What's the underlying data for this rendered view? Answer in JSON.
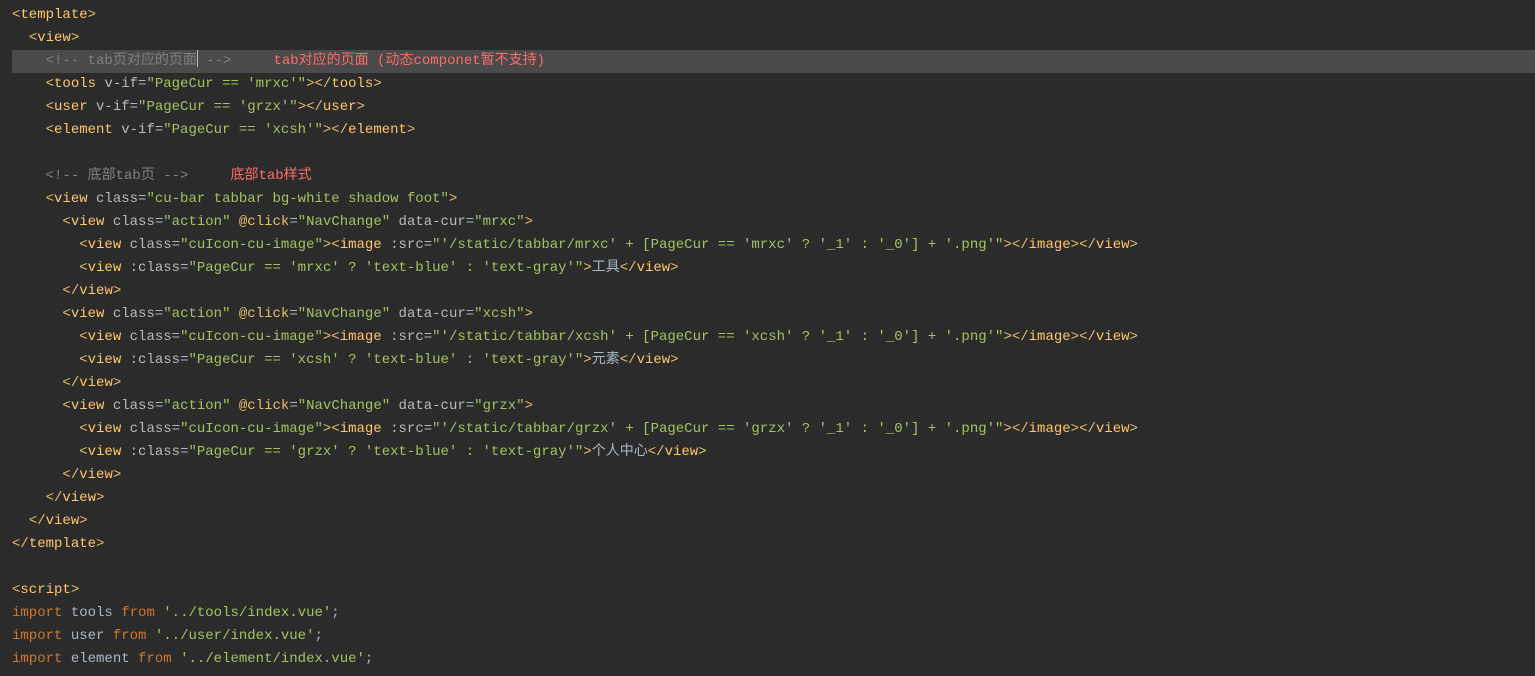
{
  "lines": {
    "l1": {
      "indent": "",
      "tokens": [
        {
          "t": "t-tag",
          "s": "<"
        },
        {
          "t": "t-custom",
          "s": "template"
        },
        {
          "t": "t-tag",
          "s": ">"
        }
      ]
    },
    "l2": {
      "indent": "  ",
      "tokens": [
        {
          "t": "t-tag",
          "s": "<"
        },
        {
          "t": "t-custom",
          "s": "view"
        },
        {
          "t": "t-tag",
          "s": ">"
        }
      ]
    },
    "l3": {
      "indent": "    ",
      "active": true,
      "tokens": [
        {
          "t": "t-comment",
          "s": "<!-- tab页对应的页面"
        },
        {
          "cursor": true
        },
        {
          "t": "t-comment",
          "s": " -->"
        },
        {
          "t": "t-text",
          "s": "     "
        },
        {
          "t": "t-anno",
          "s": "tab对应的页面 (动态componet暂不支持)"
        }
      ]
    },
    "l4": {
      "indent": "    ",
      "tokens": [
        {
          "t": "t-tag",
          "s": "<"
        },
        {
          "t": "t-custom",
          "s": "tools"
        },
        {
          "t": "t-text",
          "s": " "
        },
        {
          "t": "t-attr",
          "s": "v-if"
        },
        {
          "t": "t-eq",
          "s": "="
        },
        {
          "t": "t-str",
          "s": "\"PageCur == 'mrxc'\""
        },
        {
          "t": "t-tag",
          "s": "></"
        },
        {
          "t": "t-custom",
          "s": "tools"
        },
        {
          "t": "t-tag",
          "s": ">"
        }
      ]
    },
    "l5": {
      "indent": "    ",
      "tokens": [
        {
          "t": "t-tag",
          "s": "<"
        },
        {
          "t": "t-custom",
          "s": "user"
        },
        {
          "t": "t-text",
          "s": " "
        },
        {
          "t": "t-attr",
          "s": "v-if"
        },
        {
          "t": "t-eq",
          "s": "="
        },
        {
          "t": "t-str",
          "s": "\"PageCur == 'grzx'\""
        },
        {
          "t": "t-tag",
          "s": "></"
        },
        {
          "t": "t-custom",
          "s": "user"
        },
        {
          "t": "t-tag",
          "s": ">"
        }
      ]
    },
    "l6": {
      "indent": "    ",
      "tokens": [
        {
          "t": "t-tag",
          "s": "<"
        },
        {
          "t": "t-custom",
          "s": "element"
        },
        {
          "t": "t-text",
          "s": " "
        },
        {
          "t": "t-attr",
          "s": "v-if"
        },
        {
          "t": "t-eq",
          "s": "="
        },
        {
          "t": "t-str",
          "s": "\"PageCur == 'xcsh'\""
        },
        {
          "t": "t-tag",
          "s": "></"
        },
        {
          "t": "t-custom",
          "s": "element"
        },
        {
          "t": "t-tag",
          "s": ">"
        }
      ]
    },
    "l7": {
      "indent": "",
      "tokens": []
    },
    "l8": {
      "indent": "    ",
      "tokens": [
        {
          "t": "t-comment",
          "s": "<!-- 底部tab页 -->"
        },
        {
          "t": "t-text",
          "s": "     "
        },
        {
          "t": "t-anno",
          "s": "底部tab样式"
        }
      ]
    },
    "l9": {
      "indent": "    ",
      "tokens": [
        {
          "t": "t-tag",
          "s": "<"
        },
        {
          "t": "t-custom",
          "s": "view"
        },
        {
          "t": "t-text",
          "s": " "
        },
        {
          "t": "t-attr",
          "s": "class"
        },
        {
          "t": "t-eq",
          "s": "="
        },
        {
          "t": "t-str",
          "s": "\"cu-bar tabbar bg-white shadow foot\""
        },
        {
          "t": "t-tag",
          "s": ">"
        }
      ]
    },
    "l10": {
      "indent": "      ",
      "tokens": [
        {
          "t": "t-tag",
          "s": "<"
        },
        {
          "t": "t-custom",
          "s": "view"
        },
        {
          "t": "t-text",
          "s": " "
        },
        {
          "t": "t-attr",
          "s": "class"
        },
        {
          "t": "t-eq",
          "s": "="
        },
        {
          "t": "t-str",
          "s": "\"action\""
        },
        {
          "t": "t-text",
          "s": " "
        },
        {
          "t": "t-event",
          "s": "@click"
        },
        {
          "t": "t-eq",
          "s": "="
        },
        {
          "t": "t-str",
          "s": "\"NavChange\""
        },
        {
          "t": "t-text",
          "s": " "
        },
        {
          "t": "t-attr",
          "s": "data-cur"
        },
        {
          "t": "t-eq",
          "s": "="
        },
        {
          "t": "t-str",
          "s": "\"mrxc\""
        },
        {
          "t": "t-tag",
          "s": ">"
        }
      ]
    },
    "l11": {
      "indent": "        ",
      "tokens": [
        {
          "t": "t-tag",
          "s": "<"
        },
        {
          "t": "t-custom",
          "s": "view"
        },
        {
          "t": "t-text",
          "s": " "
        },
        {
          "t": "t-attr",
          "s": "class"
        },
        {
          "t": "t-eq",
          "s": "="
        },
        {
          "t": "t-str",
          "s": "\"cuIcon-cu-image\""
        },
        {
          "t": "t-tag",
          "s": "><"
        },
        {
          "t": "t-custom",
          "s": "image"
        },
        {
          "t": "t-text",
          "s": " "
        },
        {
          "t": "t-attr",
          "s": ":src"
        },
        {
          "t": "t-eq",
          "s": "="
        },
        {
          "t": "t-str",
          "s": "\"'/static/tabbar/mrxc' + [PageCur == 'mrxc' ? '_1' : '_0'] + '.png'\""
        },
        {
          "t": "t-tag",
          "s": "></"
        },
        {
          "t": "t-custom",
          "s": "image"
        },
        {
          "t": "t-tag",
          "s": "></"
        },
        {
          "t": "t-custom",
          "s": "view"
        },
        {
          "t": "t-tag",
          "s": ">"
        }
      ]
    },
    "l12": {
      "indent": "        ",
      "tokens": [
        {
          "t": "t-tag",
          "s": "<"
        },
        {
          "t": "t-custom",
          "s": "view"
        },
        {
          "t": "t-text",
          "s": " "
        },
        {
          "t": "t-attr",
          "s": ":class"
        },
        {
          "t": "t-eq",
          "s": "="
        },
        {
          "t": "t-str",
          "s": "\"PageCur == 'mrxc' ? 'text-blue' : 'text-gray'\""
        },
        {
          "t": "t-tag",
          "s": ">"
        },
        {
          "t": "t-text",
          "s": "工具"
        },
        {
          "t": "t-tag",
          "s": "</"
        },
        {
          "t": "t-custom",
          "s": "view"
        },
        {
          "t": "t-tag",
          "s": ">"
        }
      ]
    },
    "l13": {
      "indent": "      ",
      "tokens": [
        {
          "t": "t-tag",
          "s": "</"
        },
        {
          "t": "t-custom",
          "s": "view"
        },
        {
          "t": "t-tag",
          "s": ">"
        }
      ]
    },
    "l14": {
      "indent": "      ",
      "tokens": [
        {
          "t": "t-tag",
          "s": "<"
        },
        {
          "t": "t-custom",
          "s": "view"
        },
        {
          "t": "t-text",
          "s": " "
        },
        {
          "t": "t-attr",
          "s": "class"
        },
        {
          "t": "t-eq",
          "s": "="
        },
        {
          "t": "t-str",
          "s": "\"action\""
        },
        {
          "t": "t-text",
          "s": " "
        },
        {
          "t": "t-event",
          "s": "@click"
        },
        {
          "t": "t-eq",
          "s": "="
        },
        {
          "t": "t-str",
          "s": "\"NavChange\""
        },
        {
          "t": "t-text",
          "s": " "
        },
        {
          "t": "t-attr",
          "s": "data-cur"
        },
        {
          "t": "t-eq",
          "s": "="
        },
        {
          "t": "t-str",
          "s": "\"xcsh\""
        },
        {
          "t": "t-tag",
          "s": ">"
        }
      ]
    },
    "l15": {
      "indent": "        ",
      "tokens": [
        {
          "t": "t-tag",
          "s": "<"
        },
        {
          "t": "t-custom",
          "s": "view"
        },
        {
          "t": "t-text",
          "s": " "
        },
        {
          "t": "t-attr",
          "s": "class"
        },
        {
          "t": "t-eq",
          "s": "="
        },
        {
          "t": "t-str",
          "s": "\"cuIcon-cu-image\""
        },
        {
          "t": "t-tag",
          "s": "><"
        },
        {
          "t": "t-custom",
          "s": "image"
        },
        {
          "t": "t-text",
          "s": " "
        },
        {
          "t": "t-attr",
          "s": ":src"
        },
        {
          "t": "t-eq",
          "s": "="
        },
        {
          "t": "t-str",
          "s": "\"'/static/tabbar/xcsh' + [PageCur == 'xcsh' ? '_1' : '_0'] + '.png'\""
        },
        {
          "t": "t-tag",
          "s": "></"
        },
        {
          "t": "t-custom",
          "s": "image"
        },
        {
          "t": "t-tag",
          "s": "></"
        },
        {
          "t": "t-custom",
          "s": "view"
        },
        {
          "t": "t-tag",
          "s": ">"
        }
      ]
    },
    "l16": {
      "indent": "        ",
      "tokens": [
        {
          "t": "t-tag",
          "s": "<"
        },
        {
          "t": "t-custom",
          "s": "view"
        },
        {
          "t": "t-text",
          "s": " "
        },
        {
          "t": "t-attr",
          "s": ":class"
        },
        {
          "t": "t-eq",
          "s": "="
        },
        {
          "t": "t-str",
          "s": "\"PageCur == 'xcsh' ? 'text-blue' : 'text-gray'\""
        },
        {
          "t": "t-tag",
          "s": ">"
        },
        {
          "t": "t-text",
          "s": "元素"
        },
        {
          "t": "t-tag",
          "s": "</"
        },
        {
          "t": "t-custom",
          "s": "view"
        },
        {
          "t": "t-tag",
          "s": ">"
        }
      ]
    },
    "l17": {
      "indent": "      ",
      "tokens": [
        {
          "t": "t-tag",
          "s": "</"
        },
        {
          "t": "t-custom",
          "s": "view"
        },
        {
          "t": "t-tag",
          "s": ">"
        }
      ]
    },
    "l18": {
      "indent": "      ",
      "tokens": [
        {
          "t": "t-tag",
          "s": "<"
        },
        {
          "t": "t-custom",
          "s": "view"
        },
        {
          "t": "t-text",
          "s": " "
        },
        {
          "t": "t-attr",
          "s": "class"
        },
        {
          "t": "t-eq",
          "s": "="
        },
        {
          "t": "t-str",
          "s": "\"action\""
        },
        {
          "t": "t-text",
          "s": " "
        },
        {
          "t": "t-event",
          "s": "@click"
        },
        {
          "t": "t-eq",
          "s": "="
        },
        {
          "t": "t-str",
          "s": "\"NavChange\""
        },
        {
          "t": "t-text",
          "s": " "
        },
        {
          "t": "t-attr",
          "s": "data-cur"
        },
        {
          "t": "t-eq",
          "s": "="
        },
        {
          "t": "t-str",
          "s": "\"grzx\""
        },
        {
          "t": "t-tag",
          "s": ">"
        }
      ]
    },
    "l19": {
      "indent": "        ",
      "tokens": [
        {
          "t": "t-tag",
          "s": "<"
        },
        {
          "t": "t-custom",
          "s": "view"
        },
        {
          "t": "t-text",
          "s": " "
        },
        {
          "t": "t-attr",
          "s": "class"
        },
        {
          "t": "t-eq",
          "s": "="
        },
        {
          "t": "t-str",
          "s": "\"cuIcon-cu-image\""
        },
        {
          "t": "t-tag",
          "s": "><"
        },
        {
          "t": "t-custom",
          "s": "image"
        },
        {
          "t": "t-text",
          "s": " "
        },
        {
          "t": "t-attr",
          "s": ":src"
        },
        {
          "t": "t-eq",
          "s": "="
        },
        {
          "t": "t-str",
          "s": "\"'/static/tabbar/grzx' + [PageCur == 'grzx' ? '_1' : '_0'] + '.png'\""
        },
        {
          "t": "t-tag",
          "s": "></"
        },
        {
          "t": "t-custom",
          "s": "image"
        },
        {
          "t": "t-tag",
          "s": "></"
        },
        {
          "t": "t-custom",
          "s": "view"
        },
        {
          "t": "t-tag",
          "s": ">"
        }
      ]
    },
    "l20": {
      "indent": "        ",
      "tokens": [
        {
          "t": "t-tag",
          "s": "<"
        },
        {
          "t": "t-custom",
          "s": "view"
        },
        {
          "t": "t-text",
          "s": " "
        },
        {
          "t": "t-attr",
          "s": ":class"
        },
        {
          "t": "t-eq",
          "s": "="
        },
        {
          "t": "t-str",
          "s": "\"PageCur == 'grzx' ? 'text-blue' : 'text-gray'\""
        },
        {
          "t": "t-tag",
          "s": ">"
        },
        {
          "t": "t-text",
          "s": "个人中心"
        },
        {
          "t": "t-tag",
          "s": "</"
        },
        {
          "t": "t-custom",
          "s": "view"
        },
        {
          "t": "t-tag",
          "s": ">"
        }
      ]
    },
    "l21": {
      "indent": "      ",
      "tokens": [
        {
          "t": "t-tag",
          "s": "</"
        },
        {
          "t": "t-custom",
          "s": "view"
        },
        {
          "t": "t-tag",
          "s": ">"
        }
      ]
    },
    "l22": {
      "indent": "    ",
      "tokens": [
        {
          "t": "t-tag",
          "s": "</"
        },
        {
          "t": "t-custom",
          "s": "view"
        },
        {
          "t": "t-tag",
          "s": ">"
        }
      ]
    },
    "l23": {
      "indent": "  ",
      "tokens": [
        {
          "t": "t-tag",
          "s": "</"
        },
        {
          "t": "t-custom",
          "s": "view"
        },
        {
          "t": "t-tag",
          "s": ">"
        }
      ]
    },
    "l24": {
      "indent": "",
      "tokens": [
        {
          "t": "t-tag",
          "s": "</"
        },
        {
          "t": "t-custom",
          "s": "template"
        },
        {
          "t": "t-tag",
          "s": ">"
        }
      ]
    },
    "l25": {
      "indent": "",
      "tokens": []
    },
    "l26": {
      "indent": "",
      "tokens": [
        {
          "t": "t-tag",
          "s": "<"
        },
        {
          "t": "t-custom",
          "s": "script"
        },
        {
          "t": "t-tag",
          "s": ">"
        }
      ]
    },
    "l27": {
      "indent": "",
      "tokens": [
        {
          "t": "t-kw",
          "s": "import"
        },
        {
          "t": "t-text",
          "s": " "
        },
        {
          "t": "t-ident",
          "s": "tools"
        },
        {
          "t": "t-text",
          "s": " "
        },
        {
          "t": "t-kw",
          "s": "from"
        },
        {
          "t": "t-text",
          "s": " "
        },
        {
          "t": "t-str",
          "s": "'../tools/index.vue'"
        },
        {
          "t": "t-punc",
          "s": ";"
        }
      ]
    },
    "l28": {
      "indent": "",
      "tokens": [
        {
          "t": "t-kw",
          "s": "import"
        },
        {
          "t": "t-text",
          "s": " "
        },
        {
          "t": "t-ident",
          "s": "user"
        },
        {
          "t": "t-text",
          "s": " "
        },
        {
          "t": "t-kw",
          "s": "from"
        },
        {
          "t": "t-text",
          "s": " "
        },
        {
          "t": "t-str",
          "s": "'../user/index.vue'"
        },
        {
          "t": "t-punc",
          "s": ";"
        }
      ]
    },
    "l29": {
      "indent": "",
      "tokens": [
        {
          "t": "t-kw",
          "s": "import"
        },
        {
          "t": "t-text",
          "s": " "
        },
        {
          "t": "t-ident",
          "s": "element"
        },
        {
          "t": "t-text",
          "s": " "
        },
        {
          "t": "t-kw",
          "s": "from"
        },
        {
          "t": "t-text",
          "s": " "
        },
        {
          "t": "t-str",
          "s": "'../element/index.vue'"
        },
        {
          "t": "t-punc",
          "s": ";"
        }
      ]
    }
  },
  "order": [
    "l1",
    "l2",
    "l3",
    "l4",
    "l5",
    "l6",
    "l7",
    "l8",
    "l9",
    "l10",
    "l11",
    "l12",
    "l13",
    "l14",
    "l15",
    "l16",
    "l17",
    "l18",
    "l19",
    "l20",
    "l21",
    "l22",
    "l23",
    "l24",
    "l25",
    "l26",
    "l27",
    "l28",
    "l29"
  ]
}
